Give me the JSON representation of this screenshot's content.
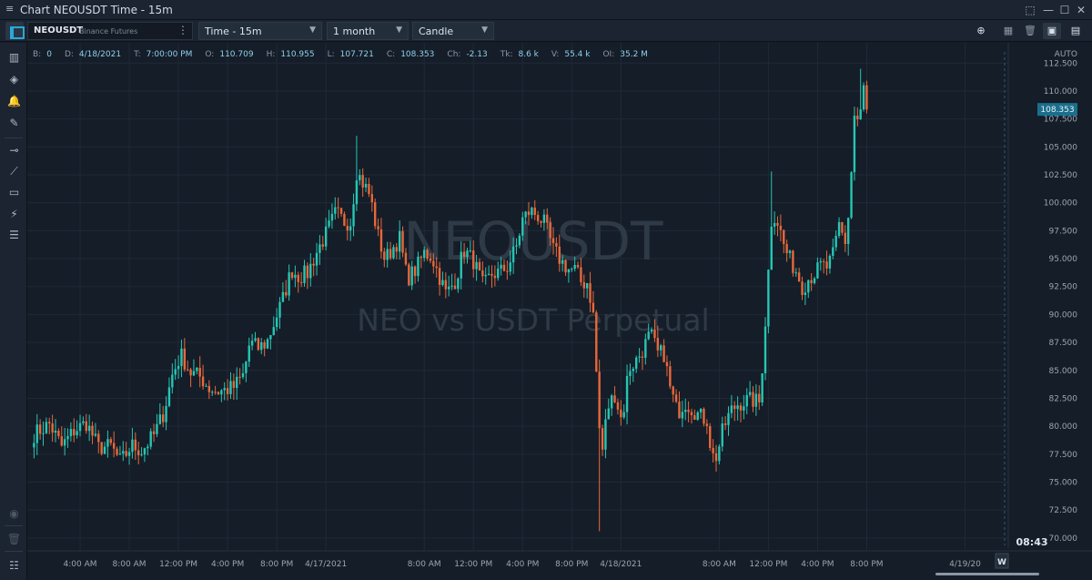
{
  "window": {
    "title": "Chart NEOUSDT Time - 15m",
    "menu_glyph": "≡",
    "controls": [
      "⬚",
      "—",
      "☐",
      "✕"
    ]
  },
  "toolbar": {
    "symbol": "NEOUSDT",
    "exchange": "Binance Futures",
    "timeframe": "Time - 15m",
    "period": "1 month",
    "chart_style": "Candle"
  },
  "info_bar": [
    {
      "key": "B:",
      "value": "0"
    },
    {
      "key": "D:",
      "value": "4/18/2021"
    },
    {
      "key": "T:",
      "value": "7:00:00 PM"
    },
    {
      "key": "O:",
      "value": "110.709"
    },
    {
      "key": "H:",
      "value": "110.955"
    },
    {
      "key": "L:",
      "value": "107.721"
    },
    {
      "key": "C:",
      "value": "108.353"
    },
    {
      "key": "Ch:",
      "value": "-2.13"
    },
    {
      "key": "Tk:",
      "value": "8.6 k"
    },
    {
      "key": "V:",
      "value": "55.4 k"
    },
    {
      "key": "OI:",
      "value": "35.2 M"
    }
  ],
  "left_tools": [
    "chart-type-icon",
    "layers-icon",
    "alert-bell-icon",
    "drawing-pencil-icon",
    "horizontal-line-icon",
    "trend-line-icon",
    "rectangle-icon",
    "fibonacci-icon",
    "object-list-icon",
    "eye-icon",
    "trash-icon",
    "list-icon"
  ],
  "colors": {
    "background": "#151d28",
    "grid": "#1f2a37",
    "up": "#26c6b4",
    "down": "#e8683a",
    "price_tag": "#1b6f8c",
    "watermark": "#2f3a47",
    "axis_text": "#9aa6b2"
  },
  "chart_data": {
    "type": "candlestick",
    "watermark_symbol": "NEOUSDT",
    "watermark_description": "NEO vs USDT  Perpetual",
    "y_axis_mode": "AUTO",
    "ylim": [
      69.5,
      113.5
    ],
    "y_ticks": [
      "112.500",
      "110.000",
      "107.500",
      "105.000",
      "102.500",
      "100.000",
      "97.500",
      "95.000",
      "92.500",
      "90.000",
      "87.500",
      "85.000",
      "82.500",
      "80.000",
      "77.500",
      "75.000",
      "72.500",
      "70.000"
    ],
    "y_tick_values": [
      112.5,
      110,
      107.5,
      105,
      102.5,
      100,
      97.5,
      95,
      92.5,
      90,
      87.5,
      85,
      82.5,
      80,
      77.5,
      75,
      72.5,
      70
    ],
    "last_price": {
      "label": "108.353",
      "value": 108.353
    },
    "countdown": "08:43",
    "x_ticks": [
      "4:00 AM",
      "8:00 AM",
      "12:00 PM",
      "4:00 PM",
      "8:00 PM",
      "4/17/2021",
      "8:00 AM",
      "12:00 PM",
      "4:00 PM",
      "8:00 PM",
      "4/18/2021",
      "8:00 AM",
      "12:00 PM",
      "4:00 PM",
      "8:00 PM",
      "4/19/20"
    ],
    "x_tick_hours": [
      4,
      8,
      12,
      16,
      20,
      24,
      32,
      36,
      40,
      44,
      48,
      56,
      60,
      64,
      68,
      76
    ],
    "x_range_hours": [
      0,
      77
    ],
    "timeframe_button": "W",
    "price_path": [
      [
        0.25,
        79.3
      ],
      [
        1.5,
        80.2
      ],
      [
        2.5,
        78.2
      ],
      [
        3.5,
        79.6
      ],
      [
        4.5,
        80.3
      ],
      [
        5.5,
        78.1
      ],
      [
        6.5,
        78.2
      ],
      [
        7.3,
        76.8
      ],
      [
        8.2,
        78.3
      ],
      [
        9,
        77.8
      ],
      [
        10,
        79.2
      ],
      [
        10.8,
        81.2
      ],
      [
        11.5,
        84.6
      ],
      [
        12.2,
        86.4
      ],
      [
        13,
        84.8
      ],
      [
        13.8,
        84.4
      ],
      [
        14.5,
        83.4
      ],
      [
        15.2,
        83.1
      ],
      [
        16,
        83.3
      ],
      [
        16.5,
        83.5
      ],
      [
        17.3,
        84.6
      ],
      [
        17.8,
        87.5
      ],
      [
        18.5,
        87.0
      ],
      [
        19.2,
        87.5
      ],
      [
        19.8,
        89.3
      ],
      [
        20.5,
        91.4
      ],
      [
        21.2,
        94.0
      ],
      [
        21.8,
        93.4
      ],
      [
        22.5,
        93.7
      ],
      [
        23.3,
        95.7
      ],
      [
        24,
        97.2
      ],
      [
        24.8,
        99.1
      ],
      [
        25.5,
        98.3
      ],
      [
        26,
        98.3
      ],
      [
        26.5,
        102.8
      ],
      [
        27,
        101.8
      ],
      [
        27.6,
        100.6
      ],
      [
        28.2,
        97.2
      ],
      [
        28.8,
        94.9
      ],
      [
        29.4,
        95.9
      ],
      [
        30,
        96.8
      ],
      [
        30.6,
        93.2
      ],
      [
        31.3,
        94.0
      ],
      [
        32,
        95.5
      ],
      [
        32.6,
        95.2
      ],
      [
        33.2,
        93.5
      ],
      [
        33.8,
        91.8
      ],
      [
        34.6,
        93.2
      ],
      [
        35.2,
        95.8
      ],
      [
        36,
        94.8
      ],
      [
        36.8,
        92.5
      ],
      [
        37.5,
        93.6
      ],
      [
        38.2,
        93.8
      ],
      [
        38.8,
        94.3
      ],
      [
        39.5,
        96.1
      ],
      [
        40,
        98.5
      ],
      [
        40.6,
        99.3
      ],
      [
        41.2,
        98.9
      ],
      [
        41.8,
        98.1
      ],
      [
        42.5,
        95.8
      ],
      [
        43.2,
        94.7
      ],
      [
        43.8,
        94.0
      ],
      [
        44.3,
        94.0
      ],
      [
        44.8,
        92.8
      ],
      [
        45.3,
        92.9
      ],
      [
        45.8,
        89.6
      ],
      [
        46.2,
        80.1
      ],
      [
        46.5,
        77.9
      ],
      [
        46.9,
        81.6
      ],
      [
        47.5,
        82.9
      ],
      [
        48.1,
        80.3
      ],
      [
        48.6,
        85.1
      ],
      [
        49.2,
        85.8
      ],
      [
        49.8,
        86.9
      ],
      [
        50.4,
        88.3
      ],
      [
        51,
        86.5
      ],
      [
        51.5,
        86.5
      ],
      [
        52,
        83.4
      ],
      [
        52.6,
        81.2
      ],
      [
        53.2,
        82.2
      ],
      [
        53.8,
        81.6
      ],
      [
        54.4,
        80.9
      ],
      [
        55,
        80.6
      ],
      [
        55.4,
        77.3
      ],
      [
        55.8,
        77.3
      ],
      [
        56.3,
        79.7
      ],
      [
        56.9,
        81.3
      ],
      [
        57.5,
        82.0
      ],
      [
        58.2,
        82.3
      ],
      [
        58.8,
        82.3
      ],
      [
        59.3,
        82.1
      ],
      [
        59.8,
        90.2
      ],
      [
        60.3,
        99.3
      ],
      [
        60.8,
        98.2
      ],
      [
        61.3,
        96.0
      ],
      [
        61.8,
        94.8
      ],
      [
        62.3,
        93.8
      ],
      [
        62.8,
        92.4
      ],
      [
        63.3,
        93.3
      ],
      [
        63.8,
        93.7
      ],
      [
        64.3,
        94.4
      ],
      [
        64.8,
        94.2
      ],
      [
        65.3,
        95.4
      ],
      [
        65.8,
        98.3
      ],
      [
        66.2,
        96.1
      ],
      [
        66.6,
        99.7
      ],
      [
        67,
        107.8
      ],
      [
        67.4,
        107.1
      ],
      [
        67.8,
        110.7
      ],
      [
        68.1,
        108.353
      ]
    ]
  }
}
